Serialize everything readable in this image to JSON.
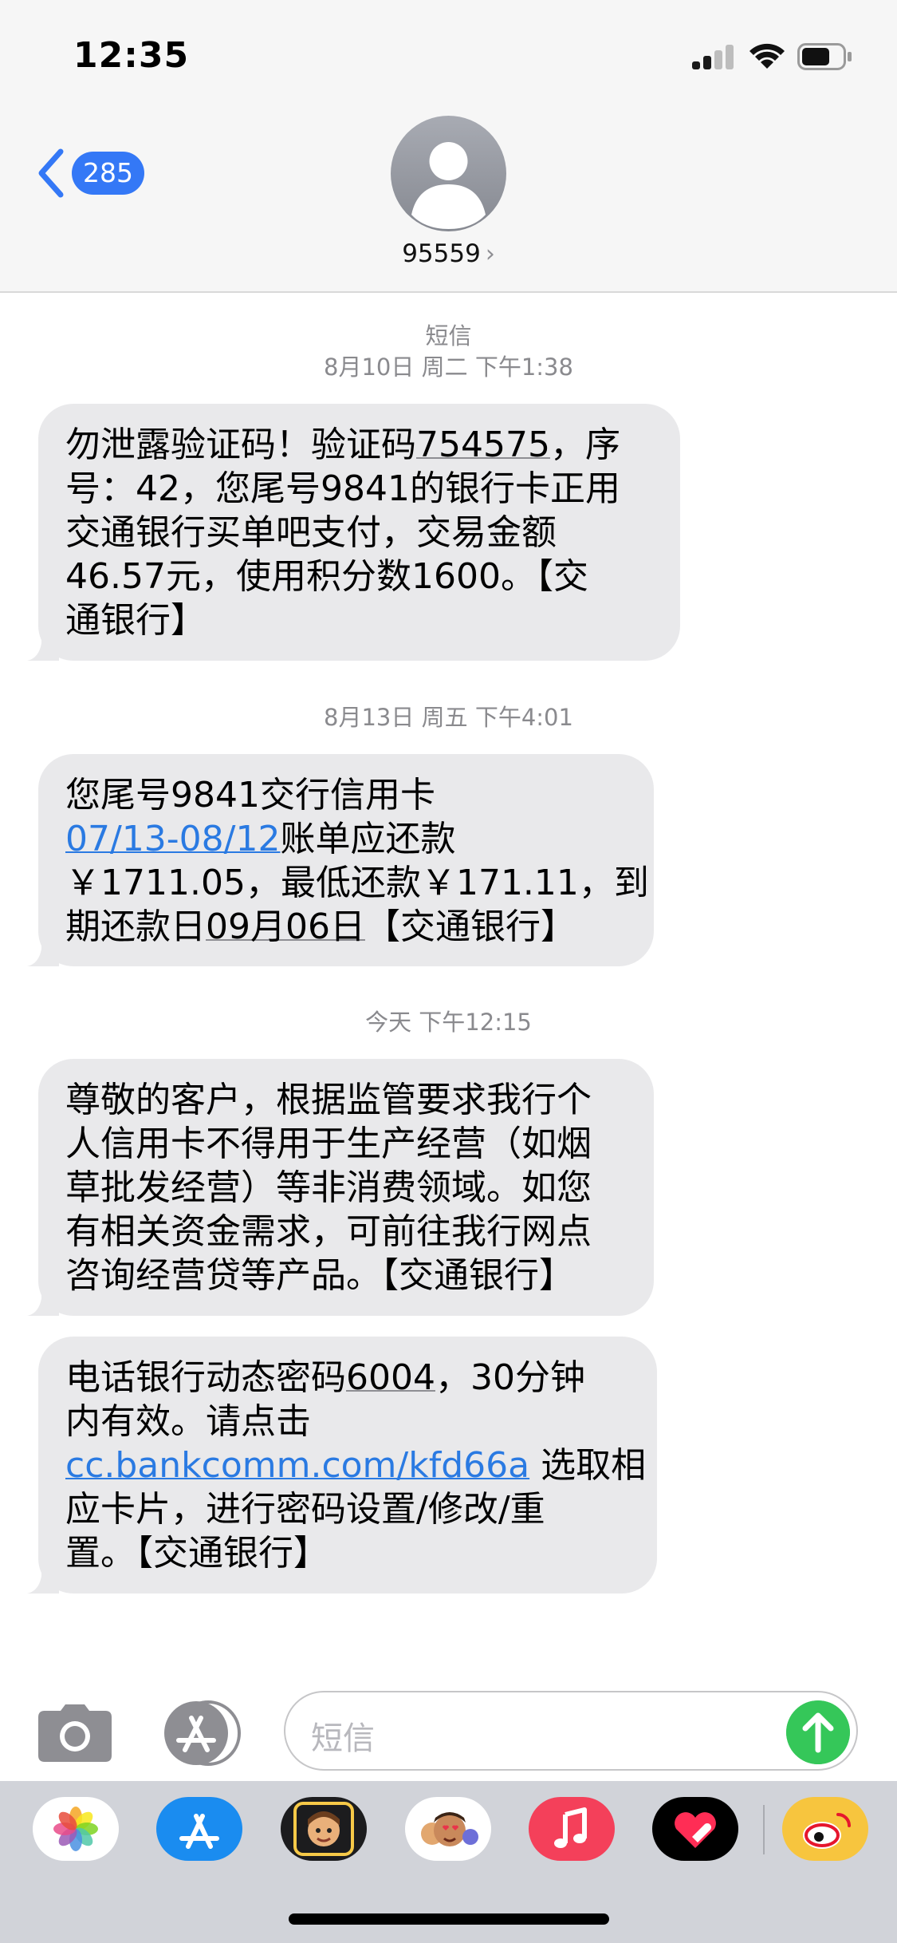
{
  "status_bar": {
    "time": "12:35"
  },
  "header": {
    "back_count": "285",
    "contact_name": "95559",
    "chevron": "›"
  },
  "messages": {
    "service_label": "短信",
    "groups": [
      {
        "timestamp": "8月10日 周二 下午1:38",
        "bubbles": [
          {
            "lines": [
              [
                "勿泄露验证码！验证码",
                "754575",
                "，序"
              ],
              [
                "号：42，您尾号9841的银行卡正用"
              ],
              [
                "交通银行买单吧支付，交易金额"
              ],
              [
                "46.57元，使用积分数1600。【交"
              ],
              [
                "通银行】"
              ]
            ]
          }
        ]
      },
      {
        "timestamp": "8月13日 周五 下午4:01",
        "bubbles": [
          {
            "lines": [
              [
                "您尾号9841交行信用卡"
              ],
              [
                "07/13-08/12",
                "账单应还款"
              ],
              [
                "￥1711.05，最低还款￥171.11，到"
              ],
              [
                "期还款日",
                "09月06日",
                "【交通银行】"
              ]
            ]
          }
        ]
      },
      {
        "timestamp": "今天 下午12:15",
        "bubbles": [
          {
            "lines": [
              [
                "尊敬的客户，根据监管要求我行个"
              ],
              [
                "人信用卡不得用于生产经营（如烟"
              ],
              [
                "草批发经营）等非消费领域。如您"
              ],
              [
                "有相关资金需求，可前往我行网点"
              ],
              [
                "咨询经营贷等产品。【交通银行】"
              ]
            ]
          },
          {
            "lines": [
              [
                "电话银行动态密码",
                "6004",
                "，30分钟"
              ],
              [
                "内有效。请点击"
              ],
              [
                "cc.bankcomm.com/kfd66a",
                " 选取相"
              ],
              [
                "应卡片，进行密码设置/修改/重"
              ],
              [
                "置。【交通银行】"
              ]
            ]
          }
        ]
      }
    ]
  },
  "input_bar": {
    "placeholder": "短信"
  },
  "icons": {
    "status": [
      "cellular-signal-icon",
      "wifi-icon",
      "battery-icon"
    ],
    "header": [
      "back-chevron-icon",
      "contact-avatar-icon"
    ],
    "input": [
      "camera-icon",
      "app-store-icon",
      "send-arrow-icon"
    ],
    "drawer": [
      "photos-app-icon",
      "app-store-app-icon",
      "memoji-app-icon",
      "animoji-app-icon",
      "music-app-icon",
      "digital-touch-app-icon",
      "weibo-app-icon"
    ]
  },
  "colors": {
    "accent_blue": "#3478f6",
    "link_blue": "#2a7ae2",
    "bubble_gray": "#e9e9eb",
    "send_green": "#35c759",
    "timestamp_gray": "#8a8a8e",
    "header_bg": "#f6f6f6",
    "drawer_bg": "#d1d3d9"
  }
}
